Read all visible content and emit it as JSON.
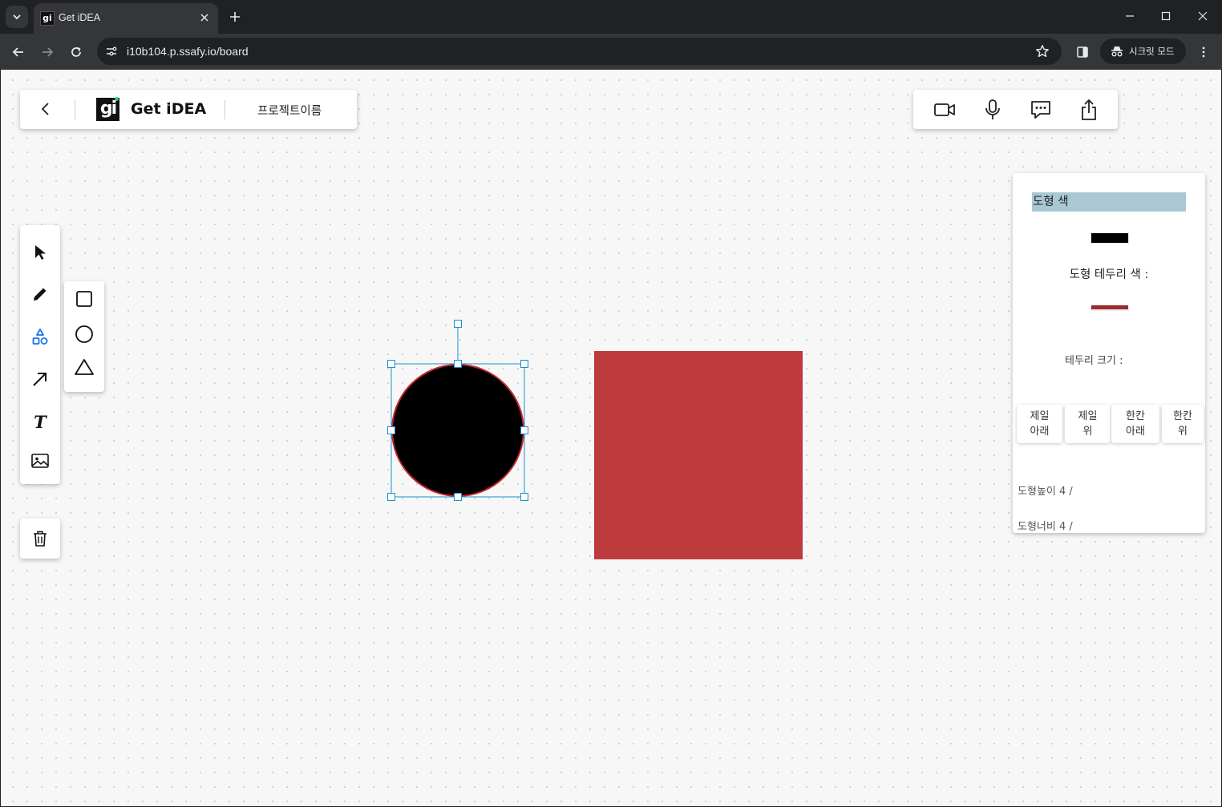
{
  "browser": {
    "tab_title": "Get iDEA",
    "favicon_text": "gi",
    "url": "i10b104.p.ssafy.io/board",
    "incognito_label": "시크릿 모드"
  },
  "header": {
    "logo_text": "gi",
    "brand": "Get iDEA",
    "project_name": "프로젝트이름"
  },
  "communication": {
    "icons": [
      "video-camera-icon",
      "microphone-icon",
      "chat-bubble-icon",
      "share-icon"
    ]
  },
  "tools": {
    "items": [
      "select-arrow-icon",
      "pencil-icon",
      "shapes-icon",
      "arrow-icon",
      "text-icon",
      "image-icon"
    ],
    "active": "shapes-icon",
    "active_color": "#1a73e8",
    "shapes": [
      "square-icon",
      "circle-icon",
      "triangle-icon"
    ],
    "delete_icon": "trash-icon",
    "text_glyph": "T"
  },
  "properties": {
    "fill_label": "도형 색",
    "fill_color": "#000000",
    "stroke_label": "도형 테두리 색 :",
    "stroke_color": "#9b2a2d",
    "stroke_size_label": "테두리 크기 :",
    "order_buttons": [
      {
        "line1": "제일",
        "line2": "아래"
      },
      {
        "line1": "제일",
        "line2": "위"
      },
      {
        "line1": "한칸",
        "line2": "아래"
      },
      {
        "line1": "한칸",
        "line2": "위"
      }
    ],
    "height_label": "도형높이 4 /",
    "width_label": "도형너비 4 /"
  },
  "canvas": {
    "circle": {
      "fill": "#000000",
      "stroke": "#c0282f",
      "selected": true
    },
    "rectangle": {
      "fill": "#bd3b3d"
    },
    "selection_color": "#1a8fd6"
  }
}
